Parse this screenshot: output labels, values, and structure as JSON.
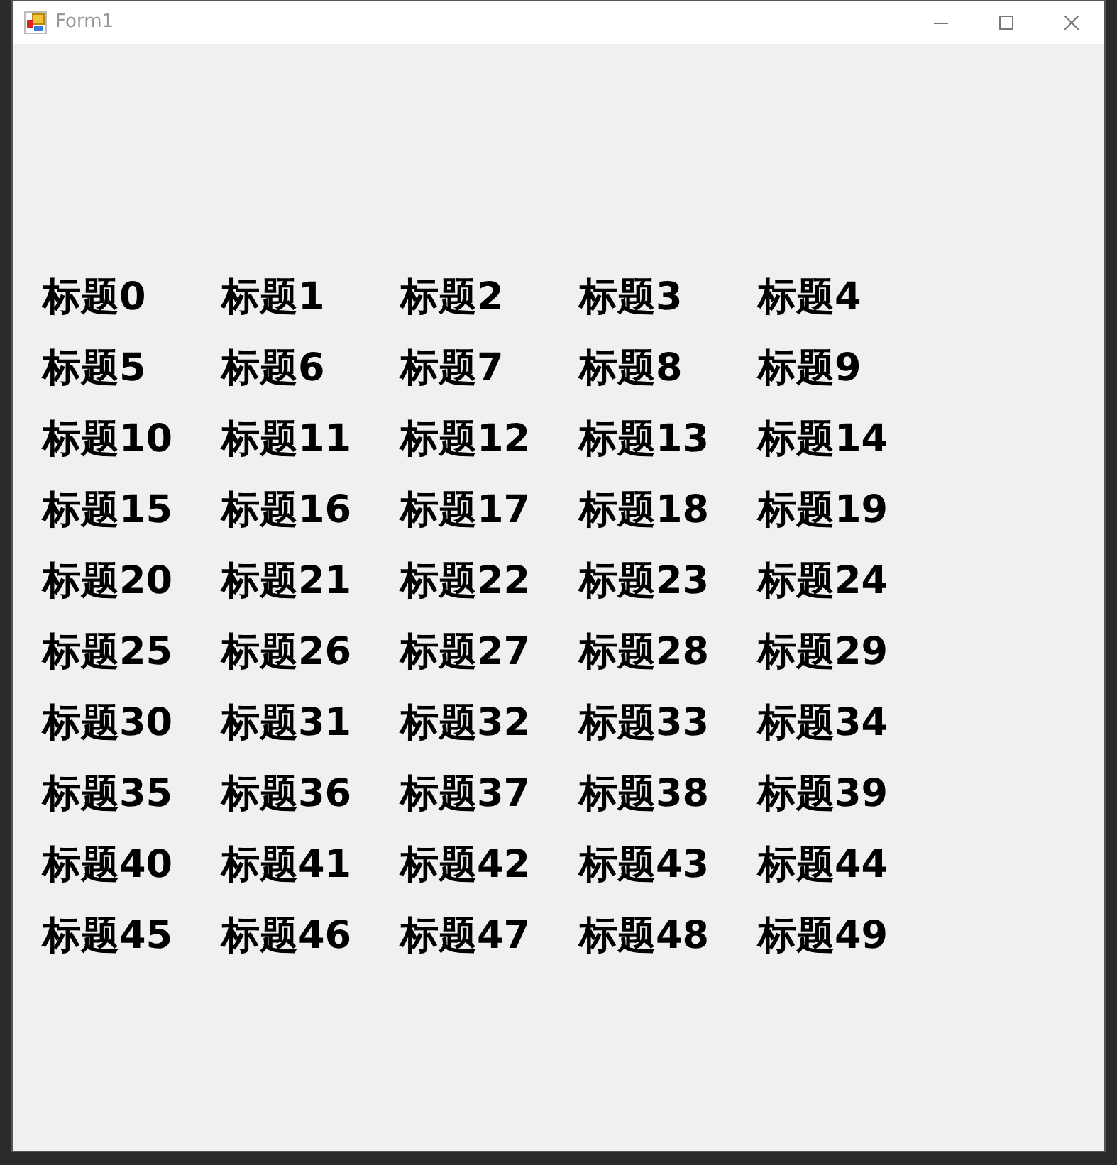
{
  "window": {
    "title": "Form1"
  },
  "labels": [
    "标题0",
    "标题1",
    "标题2",
    "标题3",
    "标题4",
    "标题5",
    "标题6",
    "标题7",
    "标题8",
    "标题9",
    "标题10",
    "标题11",
    "标题12",
    "标题13",
    "标题14",
    "标题15",
    "标题16",
    "标题17",
    "标题18",
    "标题19",
    "标题20",
    "标题21",
    "标题22",
    "标题23",
    "标题24",
    "标题25",
    "标题26",
    "标题27",
    "标题28",
    "标题29",
    "标题30",
    "标题31",
    "标题32",
    "标题33",
    "标题34",
    "标题35",
    "标题36",
    "标题37",
    "标题38",
    "标题39",
    "标题40",
    "标题41",
    "标题42",
    "标题43",
    "标题44",
    "标题45",
    "标题46",
    "标题47",
    "标题48",
    "标题49"
  ]
}
